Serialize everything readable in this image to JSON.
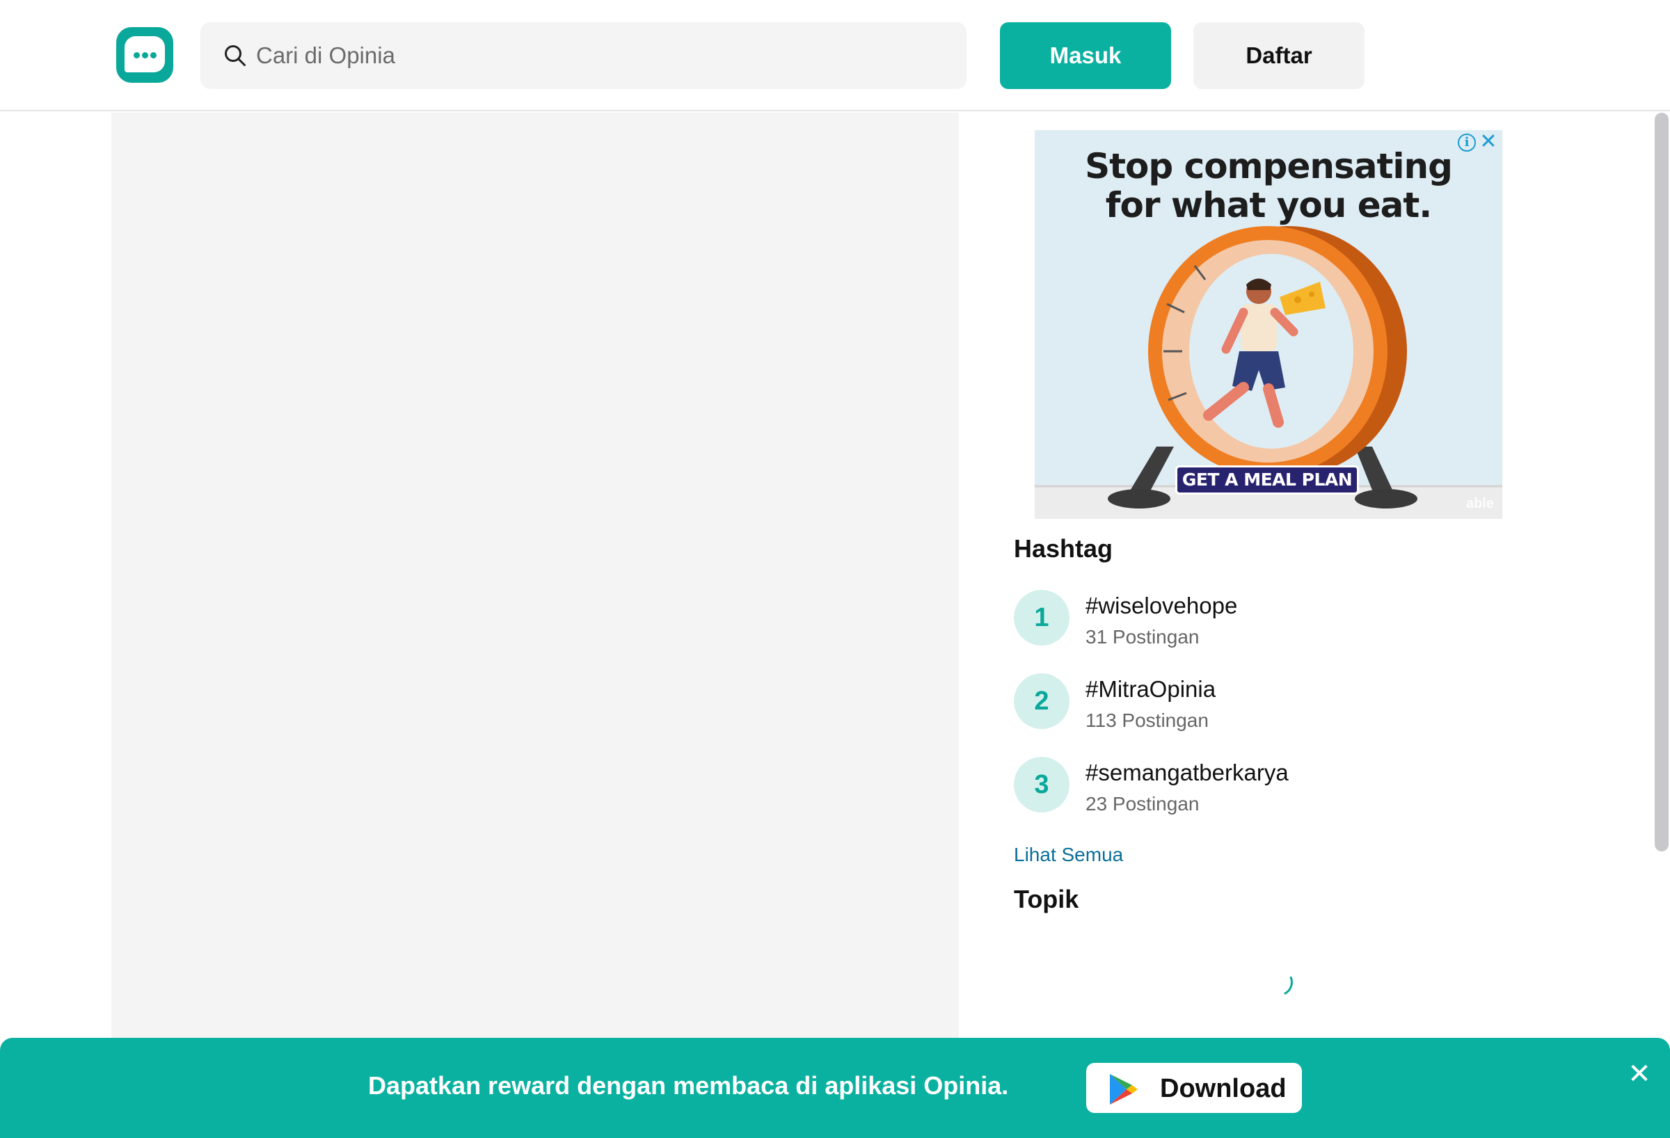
{
  "header": {
    "logo_name": "opinia-logo",
    "search_placeholder": "Cari di Opinia",
    "login_label": "Masuk",
    "register_label": "Daftar"
  },
  "ad": {
    "headline_line1": "Stop compensating",
    "headline_line2": "for what you eat.",
    "cta_label": "GET A MEAL PLAN",
    "brand": "able",
    "info_icon": "info-icon",
    "close_icon": "close-icon"
  },
  "hashtag": {
    "title": "Hashtag",
    "items": [
      {
        "rank": "1",
        "name": "#wiselovehope",
        "count": "31 Postingan"
      },
      {
        "rank": "2",
        "name": "#MitraOpinia",
        "count": "113 Postingan"
      },
      {
        "rank": "3",
        "name": "#semangatberkarya",
        "count": "23 Postingan"
      }
    ],
    "see_all": "Lihat Semua"
  },
  "topic": {
    "title": "Topik"
  },
  "banner": {
    "text": "Dapatkan reward dengan membaca di aplikasi Opinia.",
    "download_label": "Download",
    "download_icon": "google-play-icon",
    "close_icon": "close-icon"
  },
  "colors": {
    "brand": "#0ab1a0",
    "link": "#0b6e99"
  }
}
